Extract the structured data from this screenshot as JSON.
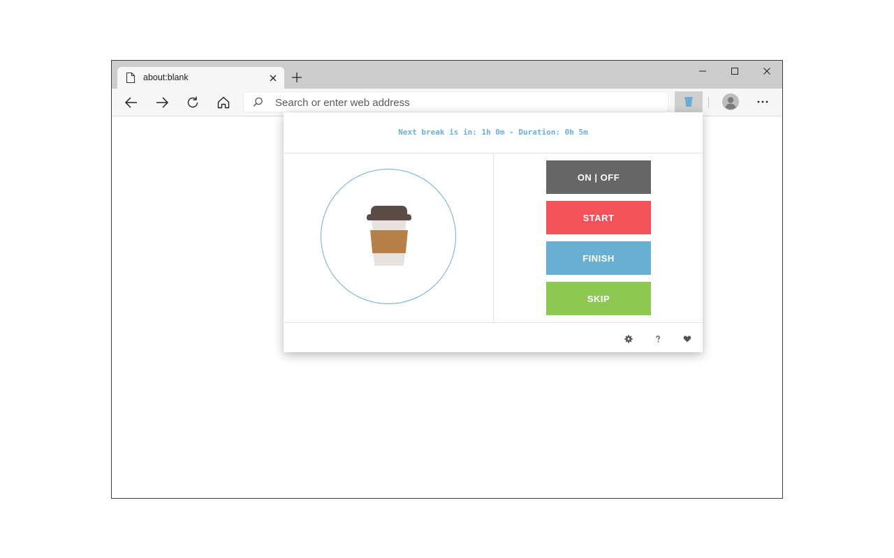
{
  "browser": {
    "tab": {
      "title": "about:blank"
    },
    "address": {
      "placeholder": "Search or enter web address"
    }
  },
  "popup": {
    "status_text": "Next break is in: 1h 0m - Duration: 0h 5m",
    "buttons": [
      {
        "label": "ON | OFF",
        "color": "#666666"
      },
      {
        "label": "START",
        "color": "#f4525a"
      },
      {
        "label": "FINISH",
        "color": "#68afd1"
      },
      {
        "label": "SKIP",
        "color": "#8ec853"
      }
    ],
    "footer_icons": [
      "gear-icon",
      "question-icon",
      "heart-icon"
    ],
    "accent_color": "#6aaed6",
    "cup_icon": "coffee-cup-icon"
  }
}
